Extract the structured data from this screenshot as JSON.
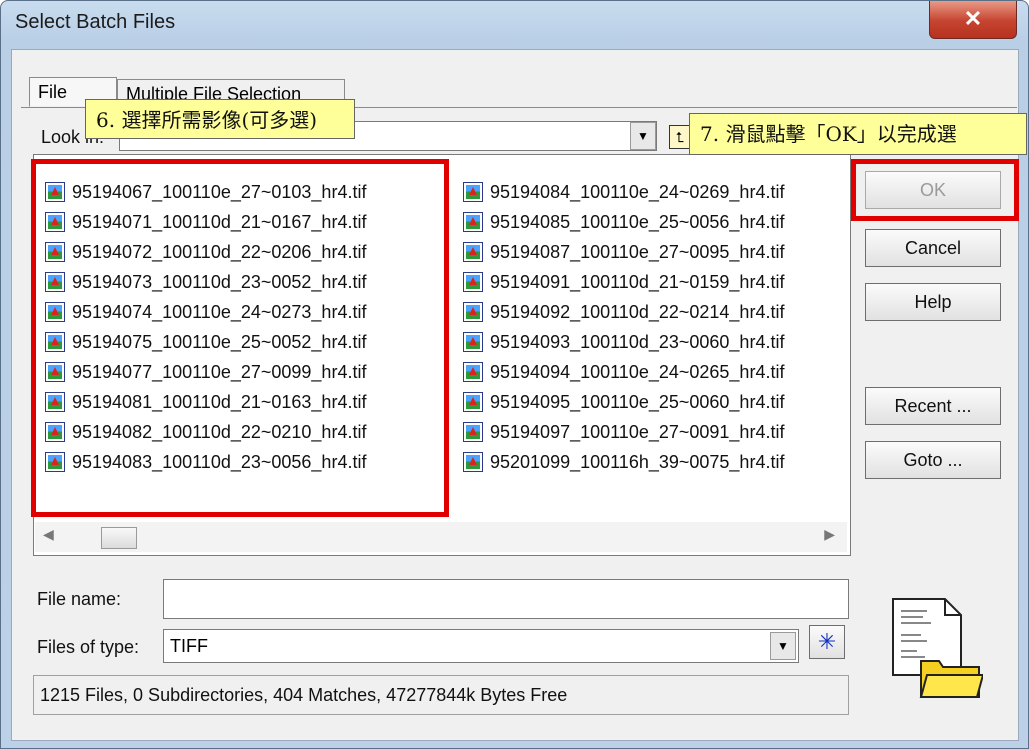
{
  "window": {
    "title": "Select Batch Files",
    "close_glyph": "✕"
  },
  "tabs": [
    {
      "label": "File"
    },
    {
      "label": "Multiple File Selection"
    }
  ],
  "look_in": {
    "label": "Look in:",
    "value": ""
  },
  "files_left": [
    "95194067_100110e_27~0103_hr4.tif",
    "95194071_100110d_21~0167_hr4.tif",
    "95194072_100110d_22~0206_hr4.tif",
    "95194073_100110d_23~0052_hr4.tif",
    "95194074_100110e_24~0273_hr4.tif",
    "95194075_100110e_25~0052_hr4.tif",
    "95194077_100110e_27~0099_hr4.tif",
    "95194081_100110d_21~0163_hr4.tif",
    "95194082_100110d_22~0210_hr4.tif",
    "95194083_100110d_23~0056_hr4.tif"
  ],
  "files_right": [
    "95194084_100110e_24~0269_hr4.tif",
    "95194085_100110e_25~0056_hr4.tif",
    "95194087_100110e_27~0095_hr4.tif",
    "95194091_100110d_21~0159_hr4.tif",
    "95194092_100110d_22~0214_hr4.tif",
    "95194093_100110d_23~0060_hr4.tif",
    "95194094_100110e_24~0265_hr4.tif",
    "95194095_100110e_25~0060_hr4.tif",
    "95194097_100110e_27~0091_hr4.tif",
    "95201099_100116h_39~0075_hr4.tif"
  ],
  "buttons": {
    "ok": "OK",
    "cancel": "Cancel",
    "help": "Help",
    "recent": "Recent ...",
    "goto": "Goto ..."
  },
  "file_name": {
    "label": "File name:",
    "value": ""
  },
  "file_type": {
    "label": "Files of type:",
    "value": "TIFF"
  },
  "status": "1215 Files, 0 Subdirectories, 404 Matches, 47277844k Bytes Free",
  "annotations": {
    "step6": "6. 選擇所需影像(可多選)",
    "step7": "7. 滑鼠點擊「OK」以完成選"
  },
  "colors": {
    "highlight_box": "#e00000",
    "callout_bg": "#ffff99",
    "title_bar": "#c9dcef",
    "close_button": "#c5432f"
  }
}
